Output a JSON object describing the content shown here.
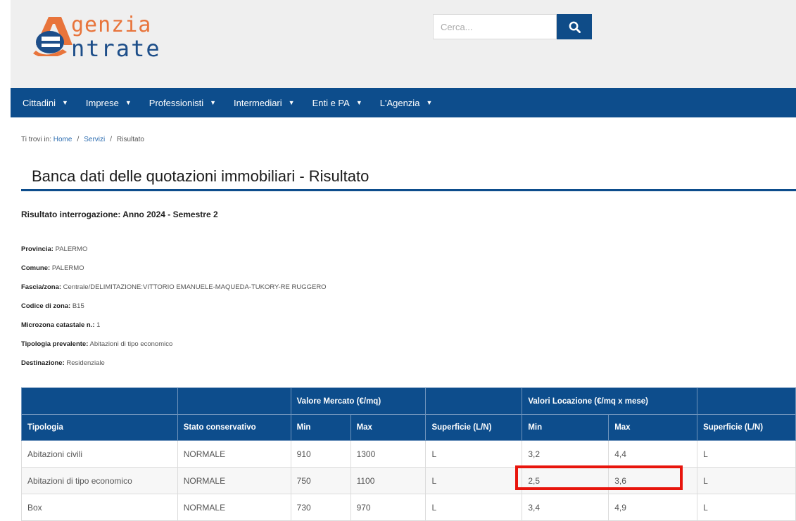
{
  "logo": {
    "line1": "genzia",
    "line2": "ntrate"
  },
  "search": {
    "placeholder": "Cerca..."
  },
  "nav": [
    {
      "label": "Cittadini"
    },
    {
      "label": "Imprese"
    },
    {
      "label": "Professionisti"
    },
    {
      "label": "Intermediari"
    },
    {
      "label": "Enti e PA"
    },
    {
      "label": "L'Agenzia"
    }
  ],
  "breadcrumb": {
    "prefix": "Ti trovi in:",
    "home": "Home",
    "services": "Servizi",
    "current": "Risultato"
  },
  "page_title": "Banca dati delle quotazioni immobiliari - Risultato",
  "subtitle": "Risultato interrogazione: Anno 2024 - Semestre 2",
  "info": [
    {
      "label": "Provincia:",
      "value": "PALERMO"
    },
    {
      "label": "Comune:",
      "value": "PALERMO"
    },
    {
      "label": "Fascia/zona:",
      "value": "Centrale/DELIMITAZIONE:VITTORIO EMANUELE-MAQUEDA-TUKORY-RE RUGGERO"
    },
    {
      "label": "Codice di zona:",
      "value": "B15"
    },
    {
      "label": "Microzona catastale n.:",
      "value": "1"
    },
    {
      "label": "Tipologia prevalente:",
      "value": "Abitazioni di tipo economico"
    },
    {
      "label": "Destinazione:",
      "value": "Residenziale"
    }
  ],
  "table": {
    "group_headers": {
      "market": "Valore Mercato (€/mq)",
      "rent": "Valori Locazione (€/mq x mese)"
    },
    "columns": [
      "Tipologia",
      "Stato conservativo",
      "Min",
      "Max",
      "Superficie (L/N)",
      "Min",
      "Max",
      "Superficie (L/N)"
    ],
    "rows": [
      [
        "Abitazioni civili",
        "NORMALE",
        "910",
        "1300",
        "L",
        "3,2",
        "4,4",
        "L"
      ],
      [
        "Abitazioni di tipo economico",
        "NORMALE",
        "750",
        "1100",
        "L",
        "2,5",
        "3,6",
        "L"
      ],
      [
        "Box",
        "NORMALE",
        "730",
        "970",
        "L",
        "3,4",
        "4,9",
        "L"
      ]
    ]
  },
  "colors": {
    "brand_blue": "#0d4d8c",
    "brand_orange": "#e8743b",
    "highlight_red": "#e8150d"
  }
}
